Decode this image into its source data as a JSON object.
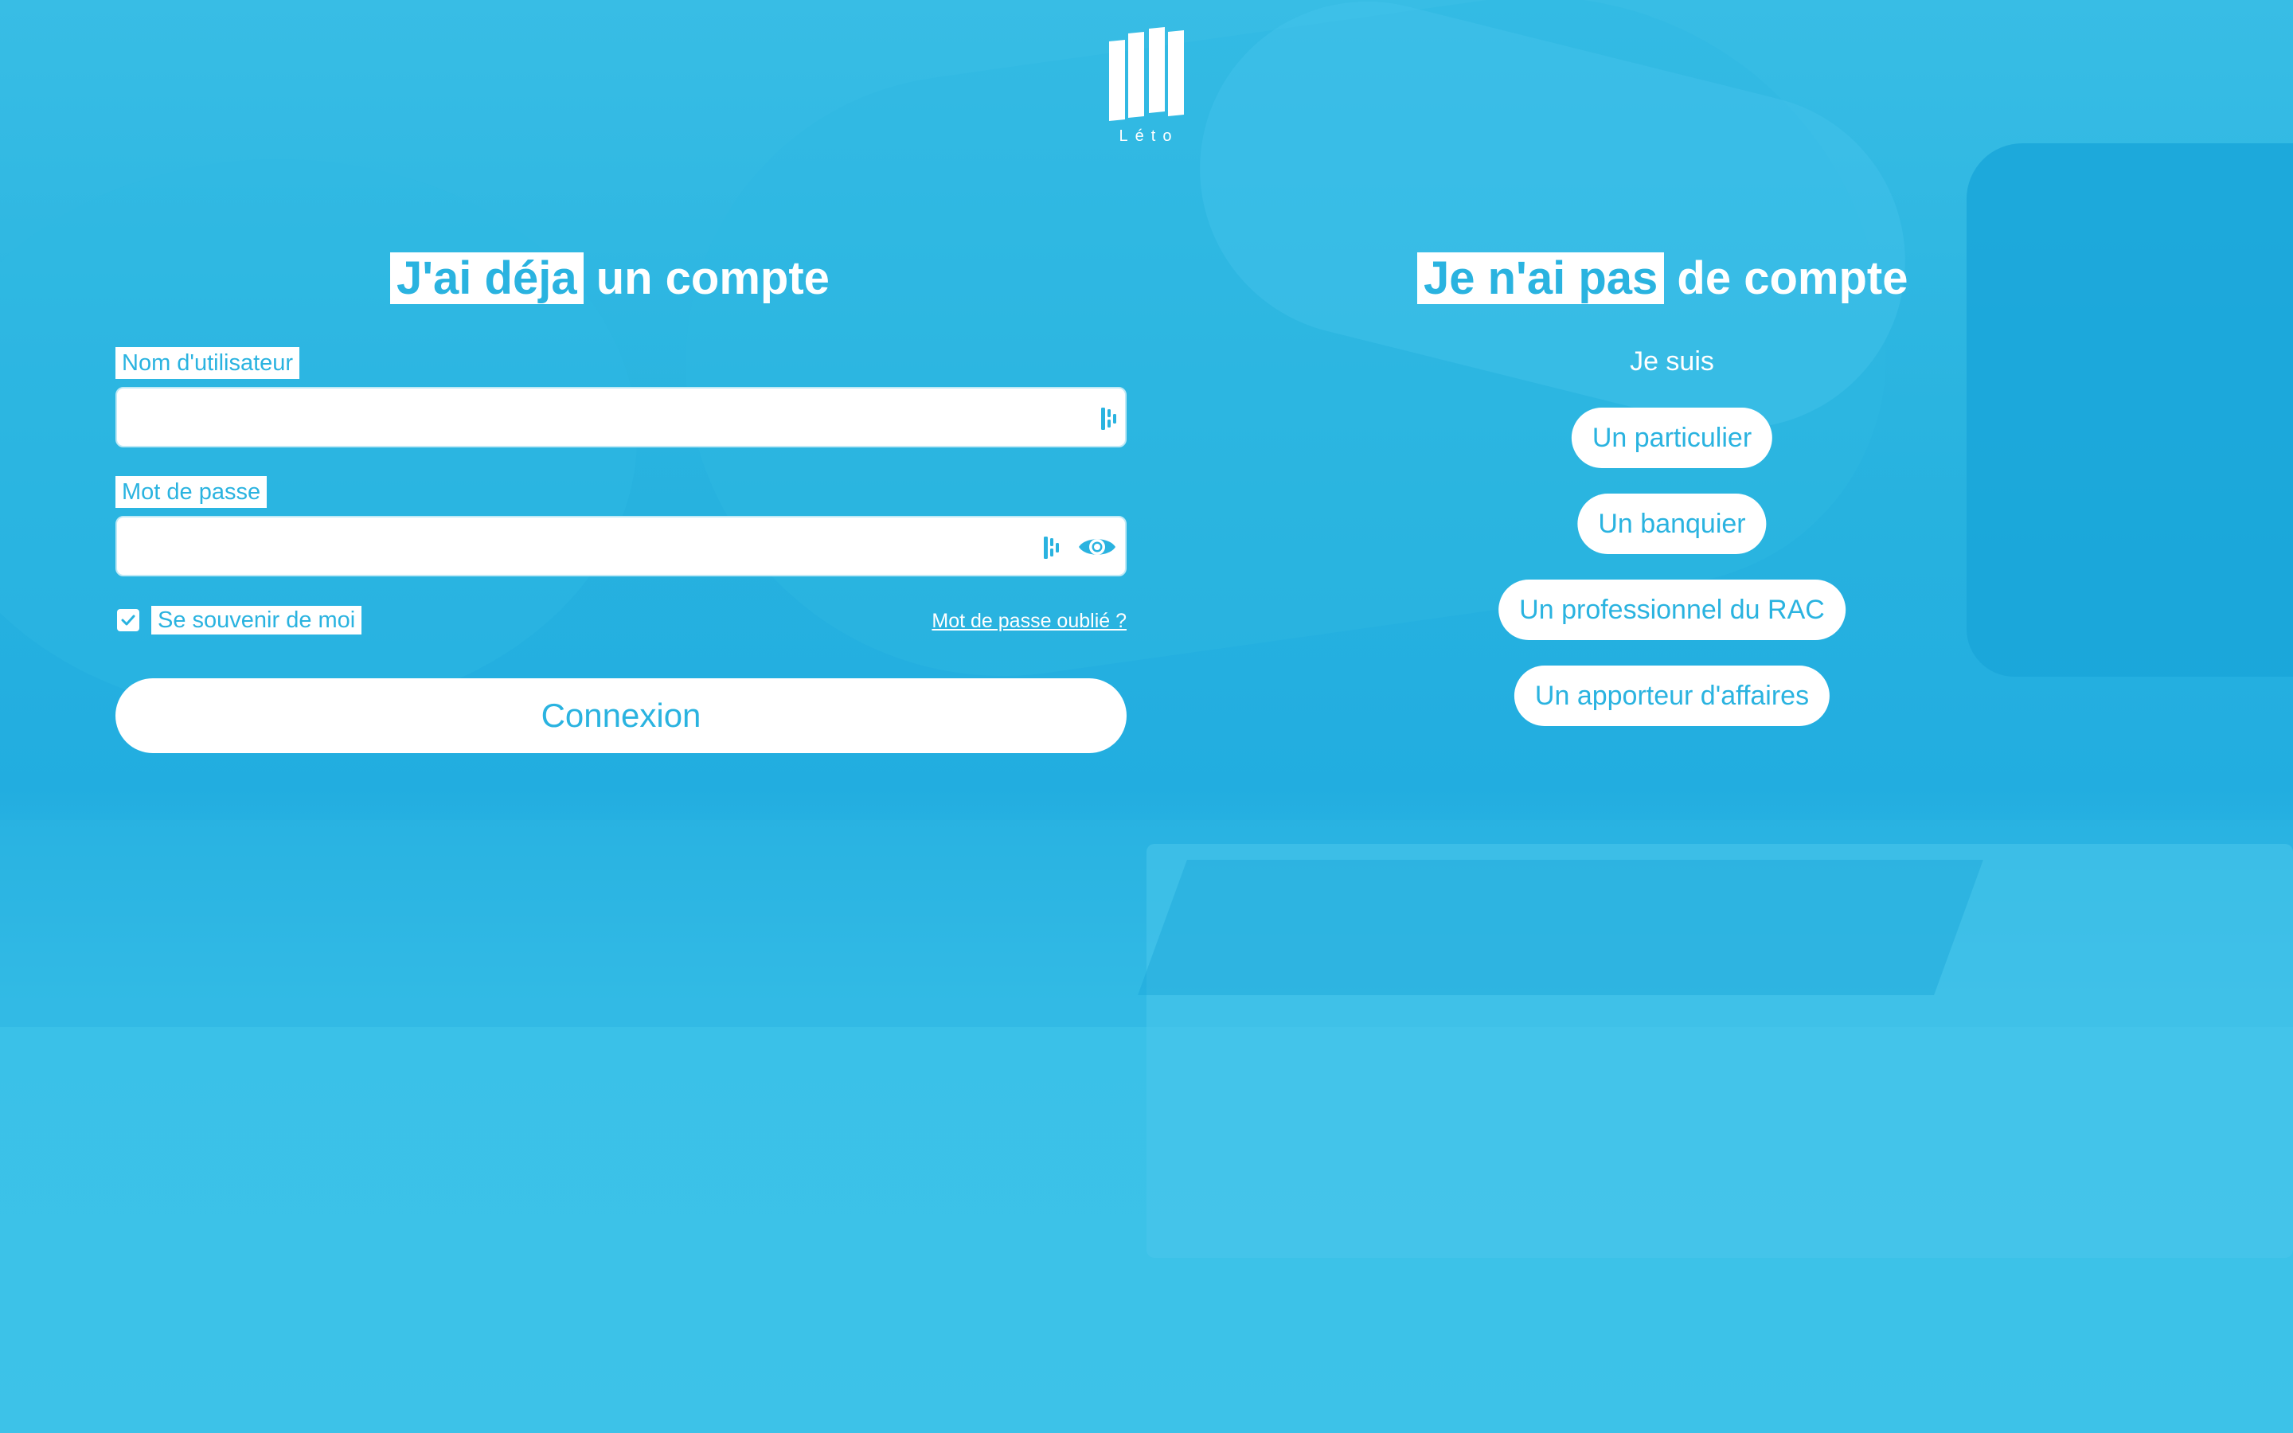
{
  "brand": {
    "name": "Léto"
  },
  "login": {
    "title_highlight": "J'ai déja",
    "title_rest": " un compte",
    "username_label": "Nom d'utilisateur",
    "username_value": "",
    "password_label": "Mot de passe",
    "password_value": "",
    "remember_label": "Se souvenir de moi",
    "remember_checked": true,
    "forgot_link": "Mot de passe oublié ?",
    "submit_label": "Connexion"
  },
  "register": {
    "title_highlight": "Je n'ai pas",
    "title_rest": " de compte",
    "intro": "Je suis",
    "roles": [
      "Un particulier",
      "Un banquier",
      "Un professionnel du RAC",
      "Un apporteur d'affaires"
    ]
  },
  "colors": {
    "accent": "#2ab3e0",
    "background": "#3cbfe6",
    "surface": "#ffffff"
  },
  "icons": {
    "password_manager": "keepass-icon",
    "show_password": "eye-icon",
    "checkbox": "checkmark-icon"
  }
}
